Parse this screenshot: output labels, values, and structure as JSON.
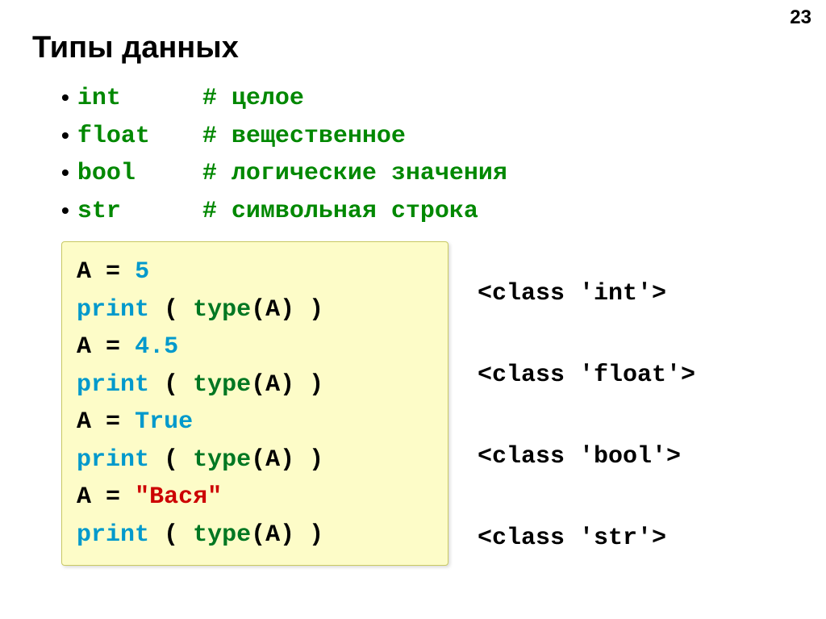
{
  "pageNumber": "23",
  "title": "Типы данных",
  "types": [
    {
      "key": "int",
      "comment": "# целое"
    },
    {
      "key": "float",
      "comment": "# вещественное"
    },
    {
      "key": "bool",
      "comment": "# логические значения"
    },
    {
      "key": "str",
      "comment": "# символьная строка"
    }
  ],
  "code": {
    "a1": "A",
    "eq": "=",
    "v1": "5",
    "print": "print",
    "type": "type",
    "lp": "(",
    "rp": ")",
    "arg": "A",
    "v2": "4.5",
    "vtrue": "True",
    "vstring": "\"Вася\""
  },
  "outputs": [
    "<class 'int'>",
    "<class 'float'>",
    "<class 'bool'>",
    "<class 'str'>"
  ]
}
